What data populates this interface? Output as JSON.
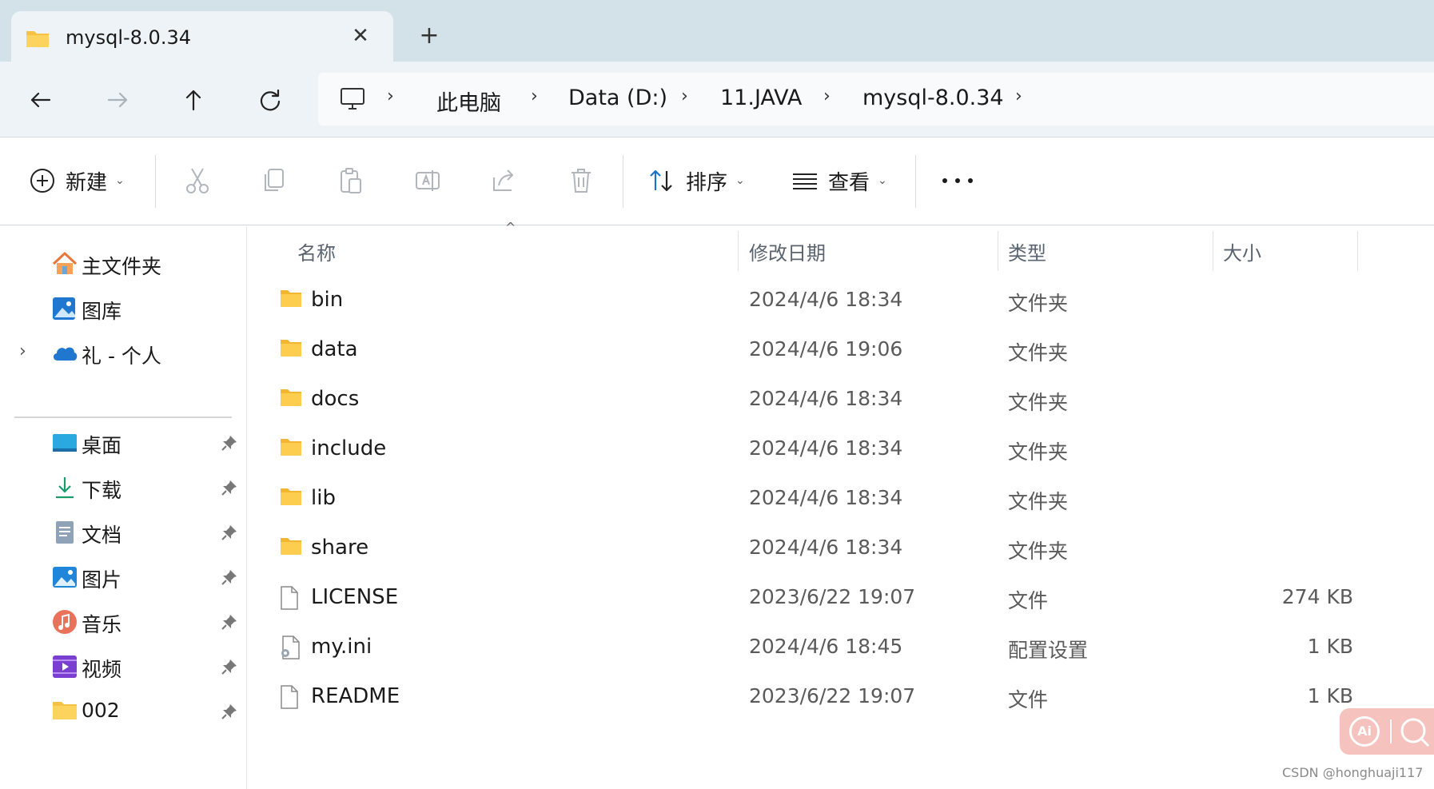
{
  "window": {
    "tab_title": "mysql-8.0.34",
    "close_symbol": "✕",
    "new_tab_symbol": "+"
  },
  "address_bar": {
    "breadcrumbs": [
      "此电脑",
      "Data (D:)",
      "11.JAVA",
      "mysql-8.0.34"
    ],
    "separator": "›"
  },
  "command_bar": {
    "new_label": "新建",
    "sort_label": "排序",
    "view_label": "查看",
    "dropdown_glyph": "⌄"
  },
  "sidebar": {
    "home": "主文件夹",
    "gallery": "图库",
    "onedrive": "礼 - 个人",
    "expander_glyph": "›",
    "pinned": [
      {
        "label": "桌面",
        "icon": "desktop-icon"
      },
      {
        "label": "下载",
        "icon": "download-icon"
      },
      {
        "label": "文档",
        "icon": "documents-icon"
      },
      {
        "label": "图片",
        "icon": "pictures-icon"
      },
      {
        "label": "音乐",
        "icon": "music-icon"
      },
      {
        "label": "视频",
        "icon": "videos-icon"
      },
      {
        "label": "002",
        "icon": "folder-icon"
      }
    ]
  },
  "file_list": {
    "columns": {
      "name": "名称",
      "modified": "修改日期",
      "type": "类型",
      "size": "大小"
    },
    "sort_caret": "^",
    "rows": [
      {
        "name": "bin",
        "date": "2024/4/6 18:34",
        "type": "文件夹",
        "size": "",
        "icon": "folder-icon"
      },
      {
        "name": "data",
        "date": "2024/4/6 19:06",
        "type": "文件夹",
        "size": "",
        "icon": "folder-icon"
      },
      {
        "name": "docs",
        "date": "2024/4/6 18:34",
        "type": "文件夹",
        "size": "",
        "icon": "folder-icon"
      },
      {
        "name": "include",
        "date": "2024/4/6 18:34",
        "type": "文件夹",
        "size": "",
        "icon": "folder-icon"
      },
      {
        "name": "lib",
        "date": "2024/4/6 18:34",
        "type": "文件夹",
        "size": "",
        "icon": "folder-icon"
      },
      {
        "name": "share",
        "date": "2024/4/6 18:34",
        "type": "文件夹",
        "size": "",
        "icon": "folder-icon"
      },
      {
        "name": "LICENSE",
        "date": "2023/6/22 19:07",
        "type": "文件",
        "size": "274 KB",
        "icon": "file-icon"
      },
      {
        "name": "my.ini",
        "date": "2024/4/6 18:45",
        "type": "配置设置",
        "size": "1 KB",
        "icon": "config-file-icon"
      },
      {
        "name": "README",
        "date": "2023/6/22 19:07",
        "type": "文件",
        "size": "1 KB",
        "icon": "file-icon"
      }
    ]
  },
  "overlay": {
    "watermark": "CSDN @honghuaji117",
    "ai_label": "Ai"
  },
  "colors": {
    "folder_yellow": "#f6c244",
    "tab_bg": "#d3e1e9",
    "accent_blue": "#1a73c8"
  }
}
